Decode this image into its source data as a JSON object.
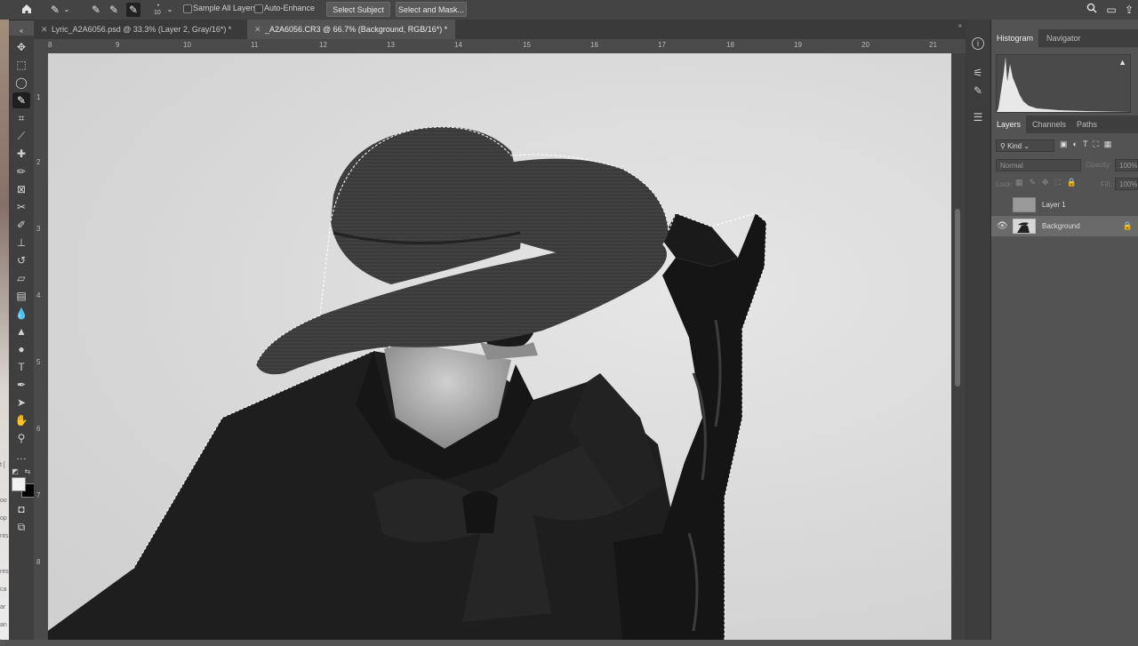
{
  "options_bar": {
    "brush_size": "10",
    "sample_all_layers": "Sample All Layers",
    "auto_enhance": "Auto-Enhance",
    "select_subject": "Select Subject",
    "select_and_mask": "Select and Mask..."
  },
  "doc_tabs": [
    {
      "title": "Lyric_A2A6056.psd @ 33.3% (Layer 2, Gray/16*) *"
    },
    {
      "title": "_A2A6056.CR3 @ 66.7% (Background, RGB/16*) *"
    }
  ],
  "ruler": {
    "horizontal": [
      "8",
      "9",
      "10",
      "11",
      "12",
      "13",
      "14",
      "15",
      "16",
      "17",
      "18",
      "19",
      "20",
      "21"
    ],
    "vertical": [
      "1",
      "2",
      "3",
      "4",
      "5",
      "6",
      "7",
      "8"
    ]
  },
  "panels": {
    "histogram_tabs": [
      "Histogram",
      "Navigator"
    ],
    "layers_tabs": [
      "Layers",
      "Channels",
      "Paths"
    ],
    "filter_kind": "Kind",
    "blend_mode": "Normal",
    "opacity_label": "Opacity:",
    "opacity_value": "100%",
    "lock_label": "Lock:",
    "fill_label": "Fill:",
    "fill_value": "100%",
    "layers": [
      {
        "name": "Layer 1",
        "visible": false
      },
      {
        "name": "Background",
        "visible": true,
        "locked": true
      }
    ]
  },
  "icons": {
    "home": "home-icon",
    "quick_select": "quick-selection-brush-icon",
    "search": "search-icon",
    "workspace": "workspace-icon",
    "share": "share-icon",
    "warning": "warning-icon",
    "visibility": "eye-icon",
    "lock": "lock-icon"
  },
  "colors": {
    "foreground_swatch": "#f0f0f0",
    "background_swatch": "#000000"
  }
}
